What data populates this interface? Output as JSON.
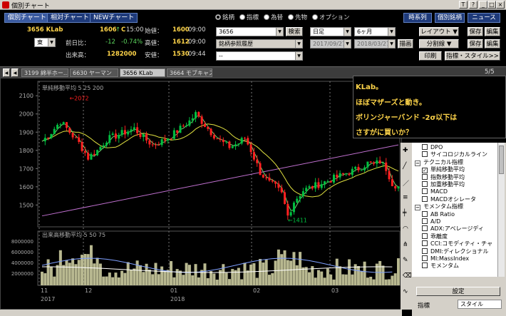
{
  "window": {
    "title": "個別チャート",
    "buttons": [
      "T",
      "?",
      "_",
      "□",
      "×"
    ]
  },
  "tabs": [
    "個別チャート",
    "相対チャート",
    "NEWチャート"
  ],
  "stock": {
    "code_name": "3656 KLab",
    "price": "1606",
    "arrow": "↑",
    "c_flag": "C",
    "time": "15:00",
    "start_label": "始値：",
    "start_value": "1600",
    "start_time": "09:00",
    "prev_label": "前日比：",
    "change": "-12",
    "change_pct": "-0.74%",
    "high_label": "高値：",
    "high_value": "1612",
    "high_time": "09:00",
    "volume_label": "出来高：",
    "volume": "1282000",
    "low_label": "安値：",
    "low_value": "1530",
    "low_time": "09:44",
    "market": "東"
  },
  "asset_radios": [
    {
      "label": "銘柄",
      "selected": true
    },
    {
      "label": "指標",
      "selected": false
    },
    {
      "label": "為替",
      "selected": false
    },
    {
      "label": "先物",
      "selected": false
    },
    {
      "label": "オプション",
      "selected": false
    }
  ],
  "search": {
    "value": "3656",
    "button": "検索",
    "history": "銘柄参照履歴",
    "blank": "--"
  },
  "period": {
    "interval": "日足",
    "range": "6ヶ月",
    "from": "2017/09/27",
    "to": "2018/03/27",
    "draw": "描画"
  },
  "right_buttons": {
    "timeseries": "時系列",
    "individual": "個別銘柄",
    "news": "ニュース",
    "layout": "レイアウト",
    "save1": "保存",
    "edit1": "編集",
    "fold": "分割線",
    "save2": "保存",
    "edit2": "編集",
    "print": "印刷",
    "indicator_style": "指標・スタイル>>"
  },
  "stock_tabs": [
    "3199 綿半ホー...",
    "6630 ヤーマン",
    "3656 KLab",
    "3664 モブキャス"
  ],
  "stock_tabs_active": 2,
  "page_indicator": "5/5",
  "chart_data": {
    "type": "candlestick",
    "main_legend": {
      "label": "単純移動平均",
      "periods": [
        "5",
        "25",
        "200"
      ]
    },
    "y_ticks": [
      "2100",
      "2000",
      "1900",
      "1800",
      "1700",
      "1600",
      "1500"
    ],
    "ylim": [
      1380,
      2140
    ],
    "annotations": [
      "←2072",
      "←1411"
    ],
    "volume_legend": {
      "label": "出来高移動平均",
      "periods": [
        "5",
        "50",
        "75"
      ]
    },
    "volume_ticks": [
      "8000000",
      "6000000",
      "4000000",
      "2000000"
    ],
    "x_month_labels": [
      "11",
      "12",
      "01",
      "02",
      "03"
    ],
    "x_year_labels": [
      "2017",
      "2018"
    ],
    "colors": {
      "up": "#00c040",
      "down": "#ff2020",
      "ma5": "#70d070",
      "ma25": "#e0e040",
      "ma200": "#c070d0",
      "volume": "#b8b890"
    }
  },
  "callout": {
    "lines": [
      "KLab。",
      "ほぼマザーズと動き。",
      "ボリンジャーバンド -2σ以下は",
      "さすがに買いか？"
    ]
  },
  "indicator_tree": [
    {
      "label": "DPO",
      "type": "check",
      "checked": false
    },
    {
      "label": "サイコロジカルライン",
      "type": "check",
      "checked": false
    },
    {
      "label": "テクニカル指標",
      "type": "group"
    },
    {
      "label": "単純移動平均",
      "type": "check",
      "checked": true
    },
    {
      "label": "指数移動平均",
      "type": "check",
      "checked": false
    },
    {
      "label": "加重移動平均",
      "type": "check",
      "checked": false
    },
    {
      "label": "MACD",
      "type": "check",
      "checked": false
    },
    {
      "label": "MACDオシレータ",
      "type": "check",
      "checked": false
    },
    {
      "label": "モメンタム指標",
      "type": "group"
    },
    {
      "label": "AB Ratio",
      "type": "check",
      "checked": false
    },
    {
      "label": "A/D",
      "type": "check",
      "checked": false
    },
    {
      "label": "ADX:アベレージディ",
      "type": "check",
      "checked": false
    },
    {
      "label": "乖離度",
      "type": "check",
      "checked": false
    },
    {
      "label": "CCI:コモディティ・チャ",
      "type": "check",
      "checked": false
    },
    {
      "label": "DMI:ディレクショナル",
      "type": "check",
      "checked": false
    },
    {
      "label": "MI:MassIndex",
      "type": "check",
      "checked": false
    },
    {
      "label": "モメンタム",
      "type": "check",
      "checked": false
    }
  ],
  "settings_button": "設定",
  "bottom_row": {
    "label": "指標",
    "value": "スタイル"
  }
}
